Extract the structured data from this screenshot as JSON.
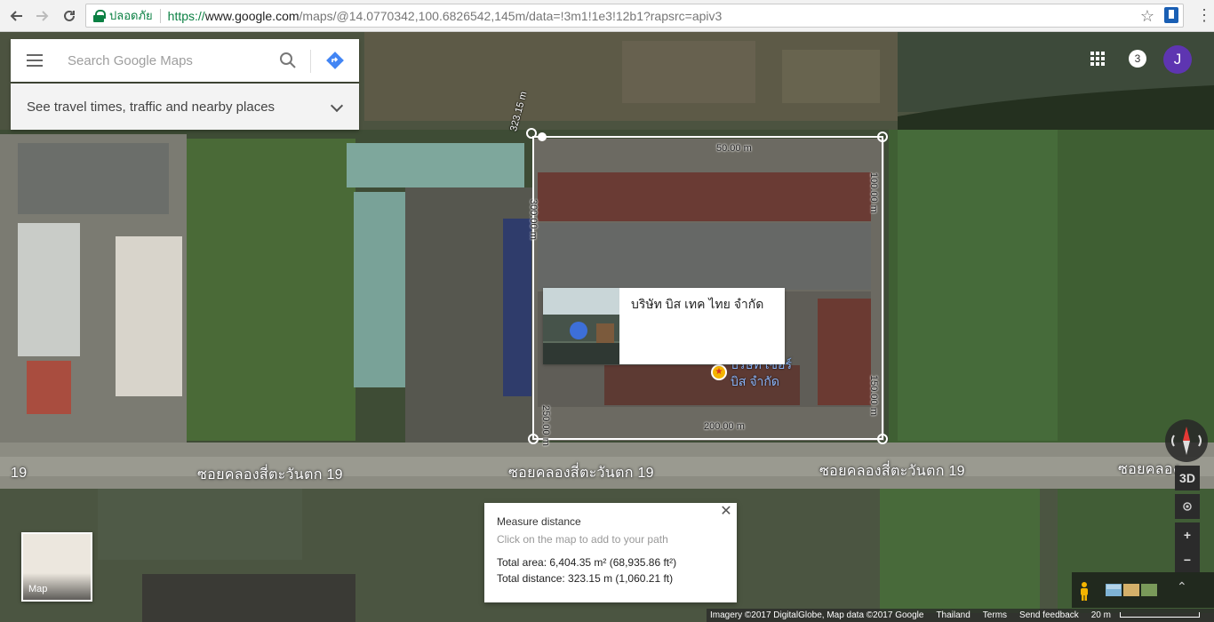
{
  "browser": {
    "secure_label": "ปลอดภัย",
    "url_scheme": "https://",
    "url_host": "www.google.com",
    "url_path": "/maps/@14.0770342,100.6826542,145m/data=!3m1!1e3!12b1?rapsrc=apiv3"
  },
  "search": {
    "placeholder": "Search Google Maps",
    "travel_text": "See travel times, traffic and nearby places"
  },
  "account": {
    "notifications": "3",
    "avatar_letter": "J"
  },
  "measure_labels": {
    "edge_top_left": "323.15 m",
    "top": "50.00 m",
    "left": "300.00 m",
    "right": "100.00 m",
    "right_lower": "150.00 m",
    "bottom": "200.00 m",
    "left_lower": "250.00 m"
  },
  "roads": {
    "left_num": "19",
    "left": "ซอยคลองสี่ตะวันตก 19",
    "center": "ซอยคลองสี่ตะวันตก 19",
    "right": "ซอยคลองสี่ตะวันตก 19",
    "far_right": "ซอยคลอง"
  },
  "place_card": {
    "name": "บริษัท บิส เทค ไทย จำกัด"
  },
  "poi": {
    "line1": "บริษัท เซอร์",
    "line2": "บิส จำกัด"
  },
  "measure_box": {
    "title": "Measure distance",
    "hint": "Click on the map to add to your path",
    "total_area": "Total area: 6,404.35 m² (68,935.86 ft²)",
    "total_distance": "Total distance: 323.15 m (1,060.21 ft)"
  },
  "map_type": {
    "label": "Map"
  },
  "controls": {
    "tilt": "3D",
    "zoom_in": "+",
    "zoom_out": "−"
  },
  "footer": {
    "imagery": "Imagery ©2017 DigitalGlobe, Map data ©2017 Google",
    "region": "Thailand",
    "terms": "Terms",
    "feedback": "Send feedback",
    "scale": "20 m"
  }
}
